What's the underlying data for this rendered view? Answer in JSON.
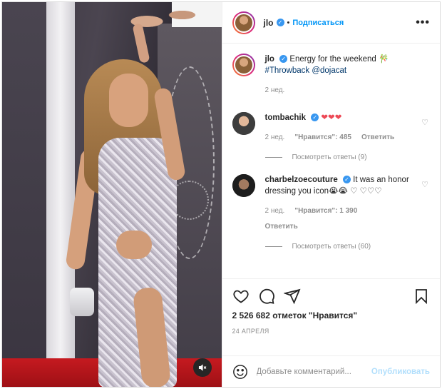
{
  "header": {
    "username": "jlo",
    "follow_label": "Подписаться",
    "separator": "•",
    "more": "•••"
  },
  "caption": {
    "username": "jlo",
    "text": "Energy for the weekend 🎋",
    "hashtag": "#Throwback",
    "mention": "@dojacat",
    "time": "2 нед."
  },
  "comments": [
    {
      "username": "tombachik",
      "text": "❤❤❤",
      "time": "2 нед.",
      "likes": "\"Нравится\": 485",
      "reply": "Ответить",
      "view_replies": "Посмотреть ответы (9)"
    },
    {
      "username": "charbelzoecouture",
      "text": "It was an honor dressing you icon😭😭 ♡ ♡♡♡",
      "time": "2 нед.",
      "likes": "\"Нравится\": 1 390",
      "reply": "Ответить",
      "view_replies": "Посмотреть ответы (60)"
    }
  ],
  "actions": {
    "likes_text": "2 526 682 отметок \"Нравится\"",
    "date": "24 АПРЕЛЯ"
  },
  "add_comment": {
    "placeholder": "Добавьте комментарий...",
    "publish_label": "Опубликовать"
  },
  "icons": {
    "like": "heart-outline-icon",
    "comment": "comment-bubble-icon",
    "share": "paper-plane-icon",
    "save": "bookmark-icon",
    "emoji": "smiley-icon",
    "mute": "speaker-muted-icon"
  },
  "colors": {
    "accent": "#0095f6",
    "verified": "#3897f0",
    "heart_red": "#ed4956",
    "publish_disabled": "#b2dffc"
  }
}
